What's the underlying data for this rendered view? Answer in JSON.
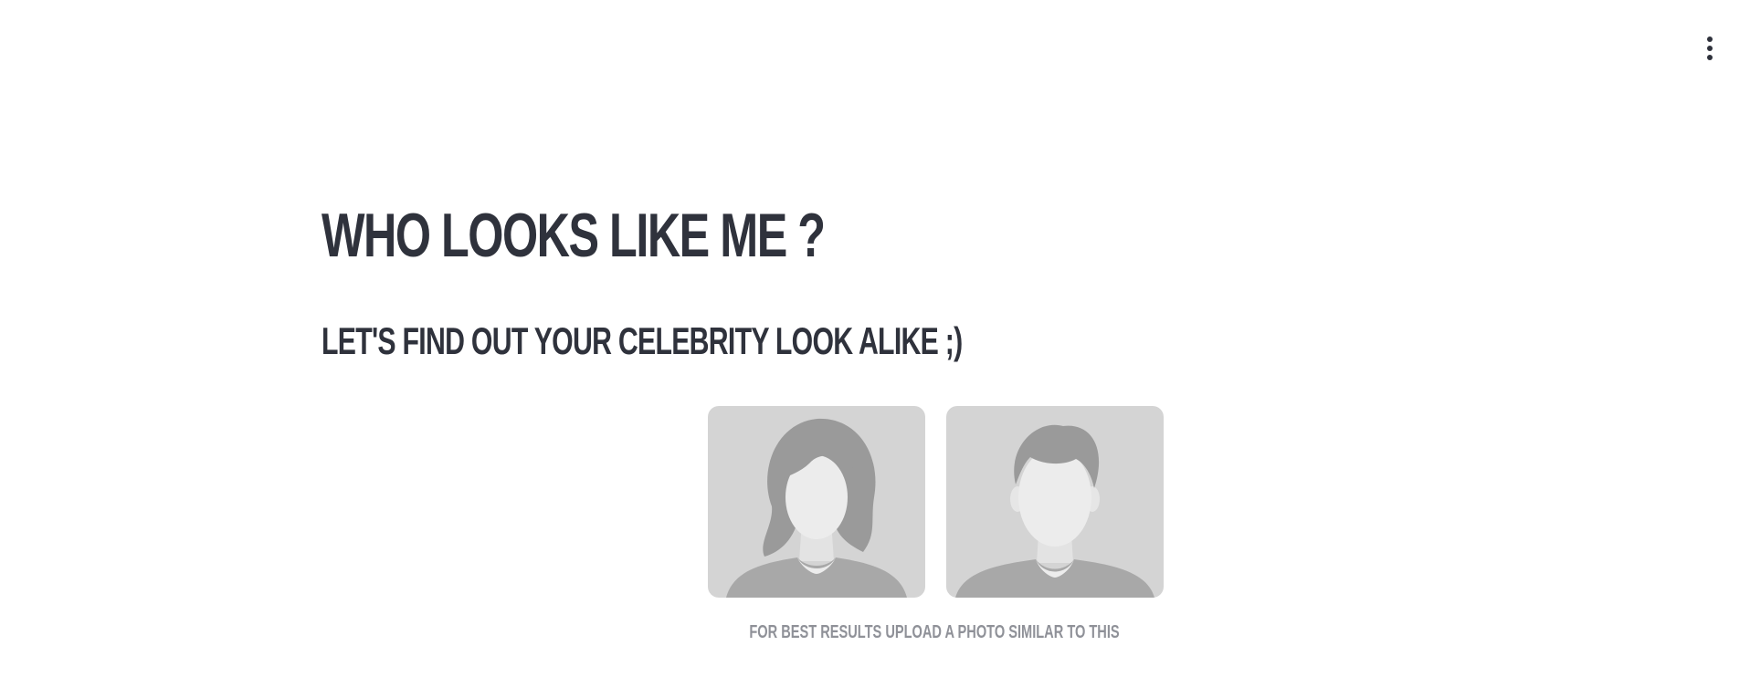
{
  "header": {
    "menu_icon": "more-vertical-icon"
  },
  "hero": {
    "title": "WHO LOOKS LIKE ME ?",
    "subtitle": "LET'S FIND OUT YOUR CELEBRITY LOOK ALIKE ;)"
  },
  "examples": {
    "female_icon": "female-avatar-icon",
    "male_icon": "male-avatar-icon",
    "hint": "FOR BEST RESULTS UPLOAD A PHOTO SIMILAR TO THIS"
  },
  "colors": {
    "text_dark": "#2f323c",
    "text_muted": "#8f9198",
    "avatar_bg": "#d4d4d4",
    "avatar_hair": "#9a9a9a",
    "avatar_skin": "#ececec",
    "avatar_body": "#a8a8a8"
  }
}
